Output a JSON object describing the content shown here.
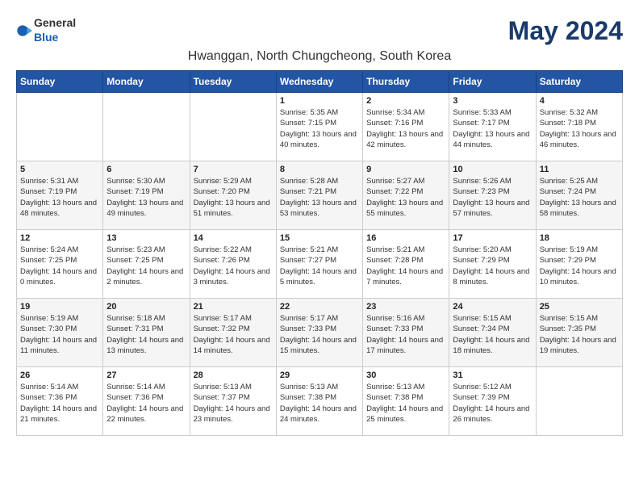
{
  "logo": {
    "general": "General",
    "blue": "Blue"
  },
  "title": "May 2024",
  "subtitle": "Hwanggan, North Chungcheong, South Korea",
  "weekdays": [
    "Sunday",
    "Monday",
    "Tuesday",
    "Wednesday",
    "Thursday",
    "Friday",
    "Saturday"
  ],
  "weeks": [
    [
      {
        "day": "",
        "sunrise": "",
        "sunset": "",
        "daylight": ""
      },
      {
        "day": "",
        "sunrise": "",
        "sunset": "",
        "daylight": ""
      },
      {
        "day": "",
        "sunrise": "",
        "sunset": "",
        "daylight": ""
      },
      {
        "day": "1",
        "sunrise": "Sunrise: 5:35 AM",
        "sunset": "Sunset: 7:15 PM",
        "daylight": "Daylight: 13 hours and 40 minutes."
      },
      {
        "day": "2",
        "sunrise": "Sunrise: 5:34 AM",
        "sunset": "Sunset: 7:16 PM",
        "daylight": "Daylight: 13 hours and 42 minutes."
      },
      {
        "day": "3",
        "sunrise": "Sunrise: 5:33 AM",
        "sunset": "Sunset: 7:17 PM",
        "daylight": "Daylight: 13 hours and 44 minutes."
      },
      {
        "day": "4",
        "sunrise": "Sunrise: 5:32 AM",
        "sunset": "Sunset: 7:18 PM",
        "daylight": "Daylight: 13 hours and 46 minutes."
      }
    ],
    [
      {
        "day": "5",
        "sunrise": "Sunrise: 5:31 AM",
        "sunset": "Sunset: 7:19 PM",
        "daylight": "Daylight: 13 hours and 48 minutes."
      },
      {
        "day": "6",
        "sunrise": "Sunrise: 5:30 AM",
        "sunset": "Sunset: 7:19 PM",
        "daylight": "Daylight: 13 hours and 49 minutes."
      },
      {
        "day": "7",
        "sunrise": "Sunrise: 5:29 AM",
        "sunset": "Sunset: 7:20 PM",
        "daylight": "Daylight: 13 hours and 51 minutes."
      },
      {
        "day": "8",
        "sunrise": "Sunrise: 5:28 AM",
        "sunset": "Sunset: 7:21 PM",
        "daylight": "Daylight: 13 hours and 53 minutes."
      },
      {
        "day": "9",
        "sunrise": "Sunrise: 5:27 AM",
        "sunset": "Sunset: 7:22 PM",
        "daylight": "Daylight: 13 hours and 55 minutes."
      },
      {
        "day": "10",
        "sunrise": "Sunrise: 5:26 AM",
        "sunset": "Sunset: 7:23 PM",
        "daylight": "Daylight: 13 hours and 57 minutes."
      },
      {
        "day": "11",
        "sunrise": "Sunrise: 5:25 AM",
        "sunset": "Sunset: 7:24 PM",
        "daylight": "Daylight: 13 hours and 58 minutes."
      }
    ],
    [
      {
        "day": "12",
        "sunrise": "Sunrise: 5:24 AM",
        "sunset": "Sunset: 7:25 PM",
        "daylight": "Daylight: 14 hours and 0 minutes."
      },
      {
        "day": "13",
        "sunrise": "Sunrise: 5:23 AM",
        "sunset": "Sunset: 7:25 PM",
        "daylight": "Daylight: 14 hours and 2 minutes."
      },
      {
        "day": "14",
        "sunrise": "Sunrise: 5:22 AM",
        "sunset": "Sunset: 7:26 PM",
        "daylight": "Daylight: 14 hours and 3 minutes."
      },
      {
        "day": "15",
        "sunrise": "Sunrise: 5:21 AM",
        "sunset": "Sunset: 7:27 PM",
        "daylight": "Daylight: 14 hours and 5 minutes."
      },
      {
        "day": "16",
        "sunrise": "Sunrise: 5:21 AM",
        "sunset": "Sunset: 7:28 PM",
        "daylight": "Daylight: 14 hours and 7 minutes."
      },
      {
        "day": "17",
        "sunrise": "Sunrise: 5:20 AM",
        "sunset": "Sunset: 7:29 PM",
        "daylight": "Daylight: 14 hours and 8 minutes."
      },
      {
        "day": "18",
        "sunrise": "Sunrise: 5:19 AM",
        "sunset": "Sunset: 7:29 PM",
        "daylight": "Daylight: 14 hours and 10 minutes."
      }
    ],
    [
      {
        "day": "19",
        "sunrise": "Sunrise: 5:19 AM",
        "sunset": "Sunset: 7:30 PM",
        "daylight": "Daylight: 14 hours and 11 minutes."
      },
      {
        "day": "20",
        "sunrise": "Sunrise: 5:18 AM",
        "sunset": "Sunset: 7:31 PM",
        "daylight": "Daylight: 14 hours and 13 minutes."
      },
      {
        "day": "21",
        "sunrise": "Sunrise: 5:17 AM",
        "sunset": "Sunset: 7:32 PM",
        "daylight": "Daylight: 14 hours and 14 minutes."
      },
      {
        "day": "22",
        "sunrise": "Sunrise: 5:17 AM",
        "sunset": "Sunset: 7:33 PM",
        "daylight": "Daylight: 14 hours and 15 minutes."
      },
      {
        "day": "23",
        "sunrise": "Sunrise: 5:16 AM",
        "sunset": "Sunset: 7:33 PM",
        "daylight": "Daylight: 14 hours and 17 minutes."
      },
      {
        "day": "24",
        "sunrise": "Sunrise: 5:15 AM",
        "sunset": "Sunset: 7:34 PM",
        "daylight": "Daylight: 14 hours and 18 minutes."
      },
      {
        "day": "25",
        "sunrise": "Sunrise: 5:15 AM",
        "sunset": "Sunset: 7:35 PM",
        "daylight": "Daylight: 14 hours and 19 minutes."
      }
    ],
    [
      {
        "day": "26",
        "sunrise": "Sunrise: 5:14 AM",
        "sunset": "Sunset: 7:36 PM",
        "daylight": "Daylight: 14 hours and 21 minutes."
      },
      {
        "day": "27",
        "sunrise": "Sunrise: 5:14 AM",
        "sunset": "Sunset: 7:36 PM",
        "daylight": "Daylight: 14 hours and 22 minutes."
      },
      {
        "day": "28",
        "sunrise": "Sunrise: 5:13 AM",
        "sunset": "Sunset: 7:37 PM",
        "daylight": "Daylight: 14 hours and 23 minutes."
      },
      {
        "day": "29",
        "sunrise": "Sunrise: 5:13 AM",
        "sunset": "Sunset: 7:38 PM",
        "daylight": "Daylight: 14 hours and 24 minutes."
      },
      {
        "day": "30",
        "sunrise": "Sunrise: 5:13 AM",
        "sunset": "Sunset: 7:38 PM",
        "daylight": "Daylight: 14 hours and 25 minutes."
      },
      {
        "day": "31",
        "sunrise": "Sunrise: 5:12 AM",
        "sunset": "Sunset: 7:39 PM",
        "daylight": "Daylight: 14 hours and 26 minutes."
      },
      {
        "day": "",
        "sunrise": "",
        "sunset": "",
        "daylight": ""
      }
    ]
  ]
}
